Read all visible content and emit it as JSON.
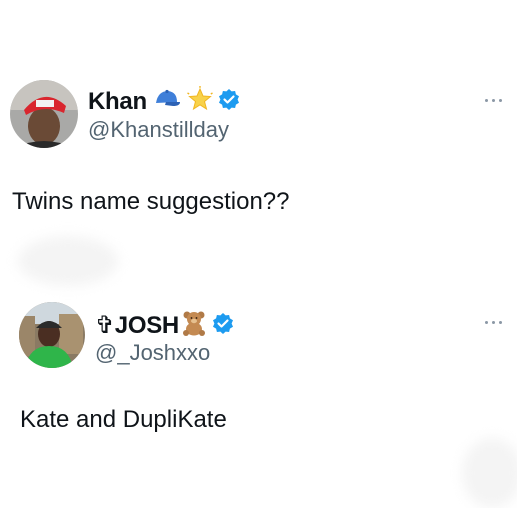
{
  "posts": [
    {
      "display_name": "Khan",
      "emoji_icons": [
        "blue-cap-icon",
        "glowing-star-icon"
      ],
      "verified": true,
      "handle": "@Khanstillday",
      "text": "Twins name suggestion??"
    },
    {
      "display_name": "✞JOSH",
      "emoji_icons": [
        "teddy-bear-icon"
      ],
      "verified": true,
      "handle": "@_Joshxxo",
      "text": "Kate and DupliKate"
    }
  ],
  "colors": {
    "text": "#0f1419",
    "secondary": "#536471",
    "verified": "#1d9bf0",
    "more": "#8b98a5"
  }
}
